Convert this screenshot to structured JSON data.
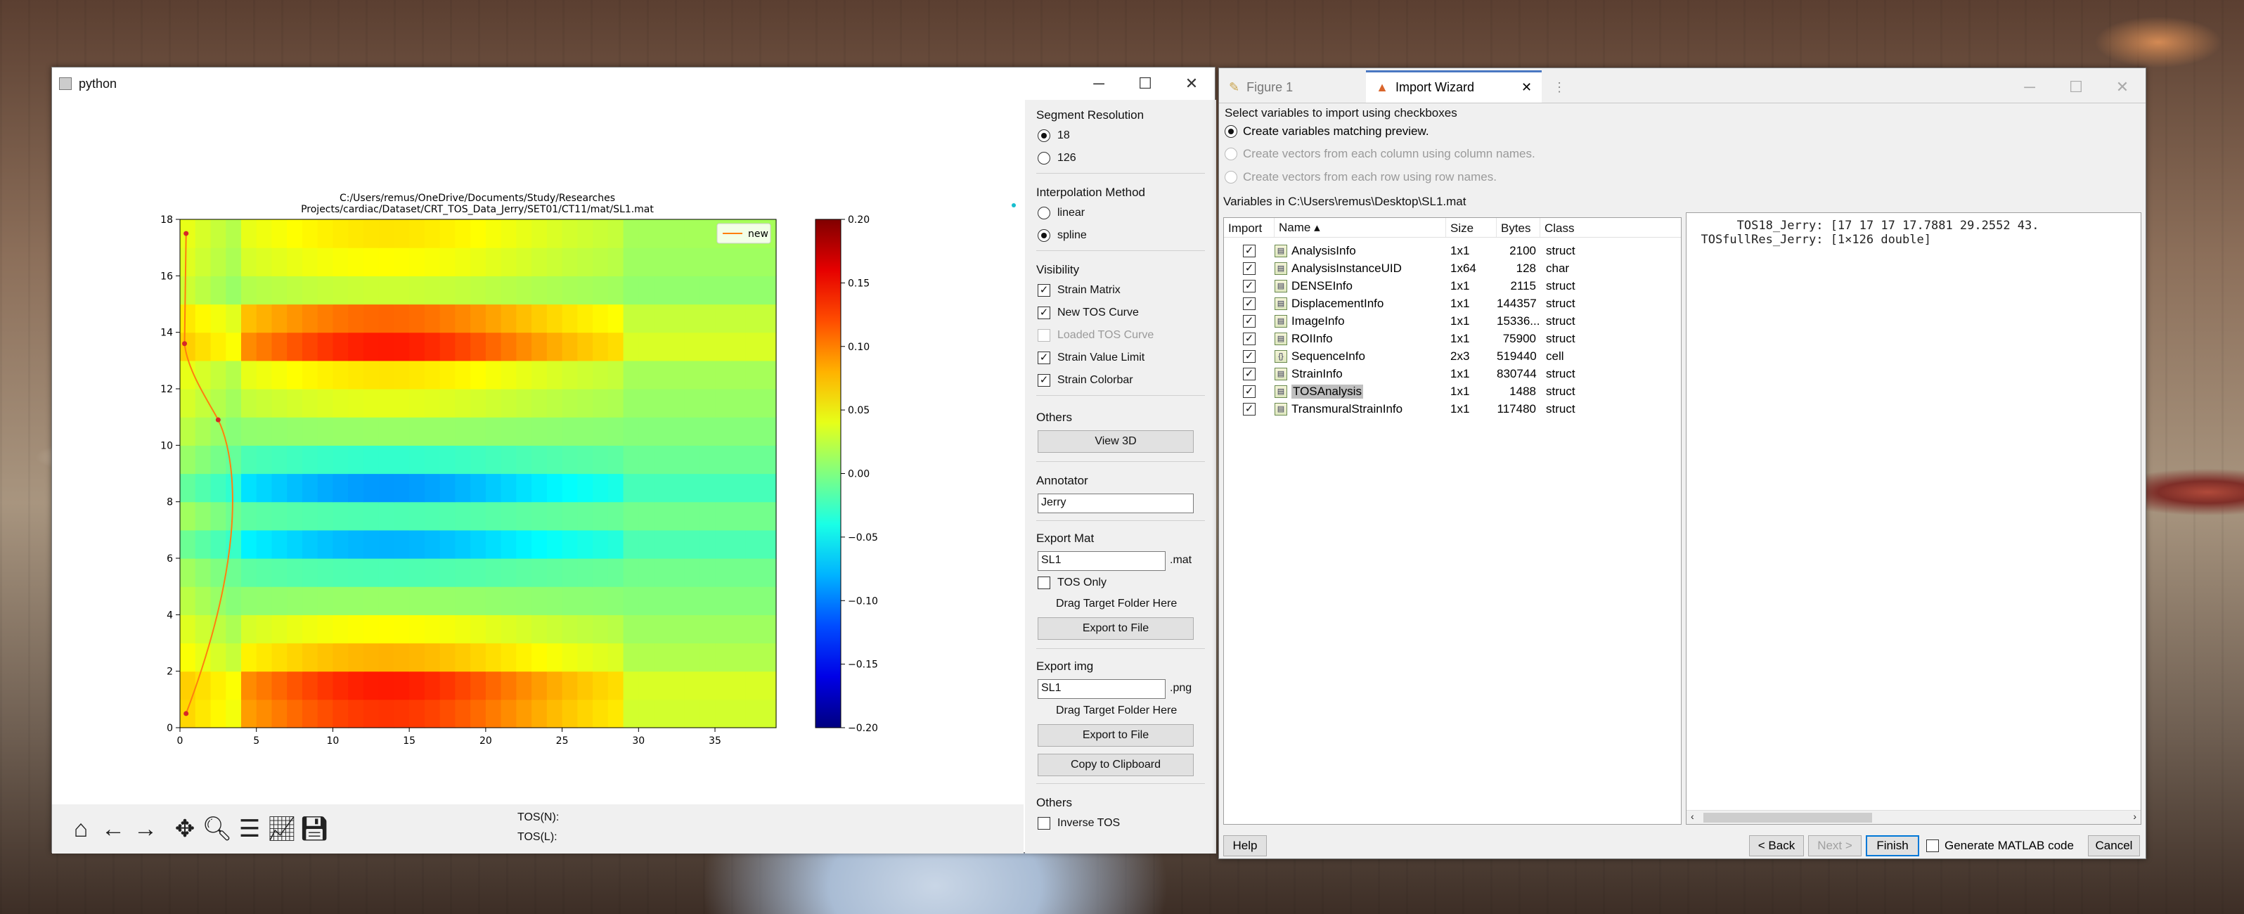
{
  "python_window": {
    "title": "python",
    "plot": {
      "title_line1": "C:/Users/remus/OneDrive/Documents/Study/Researches",
      "title_line2": "Projects/cardiac/Dataset/CRT_TOS_Data_Jerry/SET01/CT11/mat/SL1.mat",
      "legend": "new"
    },
    "side": {
      "segment_resolution": "Segment Resolution",
      "res_options": [
        "18",
        "126"
      ],
      "interpolation_method": "Interpolation Method",
      "interp_options": [
        "linear",
        "spline"
      ],
      "visibility": "Visibility",
      "vis_options": [
        "Strain Matrix",
        "New TOS Curve",
        "Loaded TOS Curve",
        "Strain Value Limit",
        "Strain Colorbar"
      ],
      "others1": "Others",
      "view3d": "View 3D",
      "annotator": "Annotator",
      "annotator_value": "Jerry",
      "export_mat": "Export Mat",
      "mat_name": "SL1",
      "mat_suffix": ".mat",
      "tos_only": "TOS Only",
      "drag_target1": "Drag Target Folder Here",
      "export_to_file1": "Export to File",
      "export_img": "Export img",
      "img_name": "SL1",
      "img_suffix": ".png",
      "drag_target2": "Drag Target Folder Here",
      "export_to_file2": "Export to File",
      "copy_clipboard": "Copy to Clipboard",
      "others2": "Others",
      "inverse_tos": "Inverse TOS"
    },
    "tos_n": "TOS(N):",
    "tos_l": "TOS(L):"
  },
  "chart_data": {
    "type": "heatmap",
    "title": "C:/Users/remus/OneDrive/Documents/Study/Researches Projects/cardiac/Dataset/CRT_TOS_Data_Jerry/SET01/CT11/mat/SL1.mat",
    "xlim": [
      0,
      39
    ],
    "ylim": [
      0,
      18
    ],
    "x_ticks": [
      0,
      5,
      10,
      15,
      20,
      25,
      30,
      35
    ],
    "y_ticks": [
      0,
      2,
      4,
      6,
      8,
      10,
      12,
      14,
      16,
      18
    ],
    "rows": 18,
    "cols": 39,
    "row_amplitude": [
      0.13,
      0.14,
      0.08,
      0.05,
      0.01,
      -0.02,
      -0.08,
      -0.02,
      -0.09,
      -0.03,
      0.01,
      0.04,
      0.06,
      0.14,
      0.11,
      0.03,
      0.05,
      0.06
    ],
    "colorbar": {
      "min": -0.2,
      "max": 0.2,
      "ticks": [
        "0.20",
        "0.15",
        "0.10",
        "0.05",
        "0.00",
        "−0.05",
        "−0.10",
        "−0.15",
        "−0.20"
      ]
    },
    "legend": "top-right",
    "series": [
      {
        "name": "new",
        "color": "#ff7f0e",
        "points": [
          [
            0.4,
            0.5
          ],
          [
            2.5,
            10.9
          ],
          [
            0.3,
            13.6
          ],
          [
            0.4,
            17.5
          ]
        ]
      }
    ]
  },
  "import_wizard": {
    "tab_figure": "Figure 1",
    "tab_import": "Import Wizard",
    "select_prompt": "Select variables to import using checkboxes",
    "opt_matching": "Create variables matching preview.",
    "opt_columns": "Create vectors from each column using column names.",
    "opt_rows": "Create vectors from each row using row names.",
    "variables_in": "Variables in C:\\Users\\remus\\Desktop\\SL1.mat",
    "columns": [
      "Import",
      "Name ▴",
      "Size",
      "Bytes",
      "Class"
    ],
    "rows": [
      {
        "name": "AnalysisInfo",
        "size": "1x1",
        "bytes": "2100",
        "class": "struct"
      },
      {
        "name": "AnalysisInstanceUID",
        "size": "1x64",
        "bytes": "128",
        "class": "char"
      },
      {
        "name": "DENSEInfo",
        "size": "1x1",
        "bytes": "2115",
        "class": "struct"
      },
      {
        "name": "DisplacementInfo",
        "size": "1x1",
        "bytes": "144357",
        "class": "struct"
      },
      {
        "name": "ImageInfo",
        "size": "1x1",
        "bytes": "15336...",
        "class": "struct"
      },
      {
        "name": "ROIInfo",
        "size": "1x1",
        "bytes": "75900",
        "class": "struct"
      },
      {
        "name": "SequenceInfo",
        "size": "2x3",
        "bytes": "519440",
        "class": "cell"
      },
      {
        "name": "StrainInfo",
        "size": "1x1",
        "bytes": "830744",
        "class": "struct"
      },
      {
        "name": "TOSAnalysis",
        "size": "1x1",
        "bytes": "1488",
        "class": "struct"
      },
      {
        "name": "TransmuralStrainInfo",
        "size": "1x1",
        "bytes": "117480",
        "class": "struct"
      }
    ],
    "preview_line1": "       TOS18_Jerry: [17 17 17 17.7881 29.2552 43.",
    "preview_line2": "  TOSfullRes_Jerry: [1×126 double]",
    "help": "Help",
    "back": "< Back",
    "next": "Next >",
    "finish": "Finish",
    "generate_code": "Generate MATLAB code",
    "cancel": "Cancel"
  }
}
